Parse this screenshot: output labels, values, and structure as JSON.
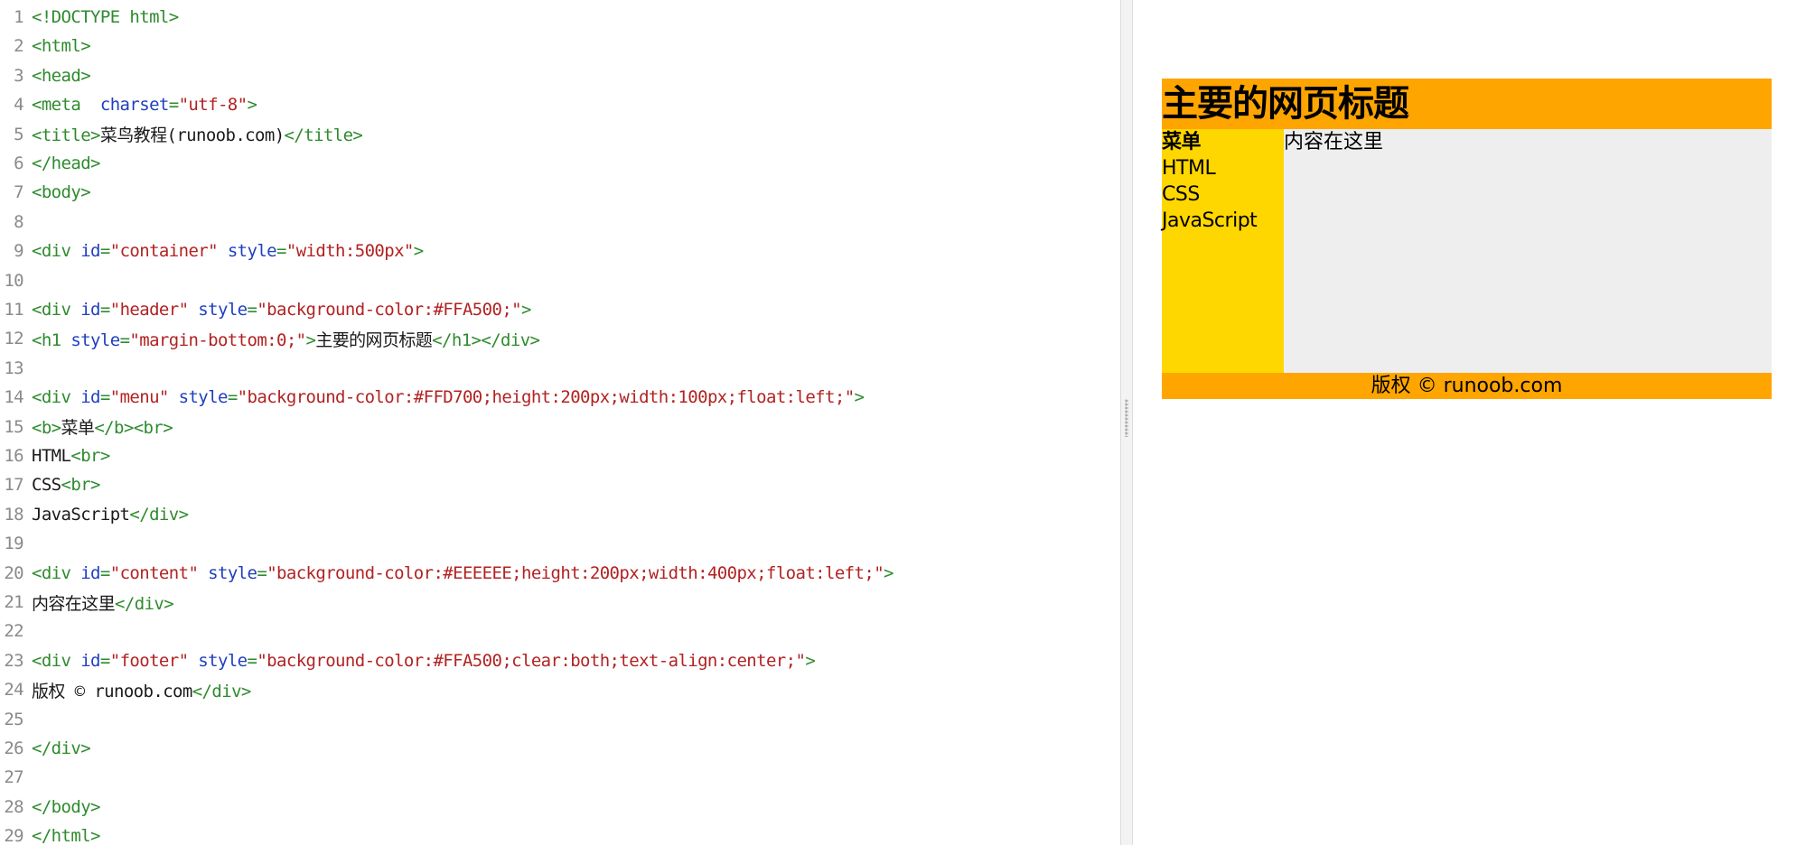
{
  "editor": {
    "lines": [
      {
        "n": "1",
        "segs": [
          {
            "t": "tag",
            "v": "<!DOCTYPE html>"
          }
        ]
      },
      {
        "n": "2",
        "segs": [
          {
            "t": "tag",
            "v": "<html>"
          }
        ]
      },
      {
        "n": "3",
        "segs": [
          {
            "t": "tag",
            "v": "<head>"
          }
        ]
      },
      {
        "n": "4",
        "segs": [
          {
            "t": "tag",
            "v": "<meta  "
          },
          {
            "t": "attr",
            "v": "charset"
          },
          {
            "t": "tag",
            "v": "="
          },
          {
            "t": "val",
            "v": "\"utf-8\""
          },
          {
            "t": "tag",
            "v": ">"
          }
        ]
      },
      {
        "n": "5",
        "segs": [
          {
            "t": "tag",
            "v": "<title>"
          },
          {
            "t": "text",
            "v": "菜鸟教程(runoob.com)"
          },
          {
            "t": "tag",
            "v": "</title>"
          }
        ]
      },
      {
        "n": "6",
        "segs": [
          {
            "t": "tag",
            "v": "</head>"
          }
        ]
      },
      {
        "n": "7",
        "segs": [
          {
            "t": "tag",
            "v": "<body>"
          }
        ]
      },
      {
        "n": "8",
        "segs": []
      },
      {
        "n": "9",
        "segs": [
          {
            "t": "tag",
            "v": "<div "
          },
          {
            "t": "attr",
            "v": "id"
          },
          {
            "t": "tag",
            "v": "="
          },
          {
            "t": "val",
            "v": "\"container\""
          },
          {
            "t": "tag",
            "v": " "
          },
          {
            "t": "attr",
            "v": "style"
          },
          {
            "t": "tag",
            "v": "="
          },
          {
            "t": "val",
            "v": "\"width:500px\""
          },
          {
            "t": "tag",
            "v": ">"
          }
        ]
      },
      {
        "n": "10",
        "segs": []
      },
      {
        "n": "11",
        "segs": [
          {
            "t": "tag",
            "v": "<div "
          },
          {
            "t": "attr",
            "v": "id"
          },
          {
            "t": "tag",
            "v": "="
          },
          {
            "t": "val",
            "v": "\"header\""
          },
          {
            "t": "tag",
            "v": " "
          },
          {
            "t": "attr",
            "v": "style"
          },
          {
            "t": "tag",
            "v": "="
          },
          {
            "t": "val",
            "v": "\"background-color:#FFA500;\""
          },
          {
            "t": "tag",
            "v": ">"
          }
        ]
      },
      {
        "n": "12",
        "segs": [
          {
            "t": "tag",
            "v": "<h1 "
          },
          {
            "t": "attr",
            "v": "style"
          },
          {
            "t": "tag",
            "v": "="
          },
          {
            "t": "val",
            "v": "\"margin-bottom:0;\""
          },
          {
            "t": "tag",
            "v": ">"
          },
          {
            "t": "text",
            "v": "主要的网页标题"
          },
          {
            "t": "tag",
            "v": "</h1></div>"
          }
        ]
      },
      {
        "n": "13",
        "segs": []
      },
      {
        "n": "14",
        "segs": [
          {
            "t": "tag",
            "v": "<div "
          },
          {
            "t": "attr",
            "v": "id"
          },
          {
            "t": "tag",
            "v": "="
          },
          {
            "t": "val",
            "v": "\"menu\""
          },
          {
            "t": "tag",
            "v": " "
          },
          {
            "t": "attr",
            "v": "style"
          },
          {
            "t": "tag",
            "v": "="
          },
          {
            "t": "val",
            "v": "\"background-color:#FFD700;height:200px;width:100px;float:left;\""
          },
          {
            "t": "tag",
            "v": ">"
          }
        ]
      },
      {
        "n": "15",
        "segs": [
          {
            "t": "tag",
            "v": "<b>"
          },
          {
            "t": "text",
            "v": "菜单"
          },
          {
            "t": "tag",
            "v": "</b><br>"
          }
        ]
      },
      {
        "n": "16",
        "segs": [
          {
            "t": "text",
            "v": "HTML"
          },
          {
            "t": "tag",
            "v": "<br>"
          }
        ]
      },
      {
        "n": "17",
        "segs": [
          {
            "t": "text",
            "v": "CSS"
          },
          {
            "t": "tag",
            "v": "<br>"
          }
        ]
      },
      {
        "n": "18",
        "segs": [
          {
            "t": "text",
            "v": "JavaScript"
          },
          {
            "t": "tag",
            "v": "</div>"
          }
        ]
      },
      {
        "n": "19",
        "segs": []
      },
      {
        "n": "20",
        "segs": [
          {
            "t": "tag",
            "v": "<div "
          },
          {
            "t": "attr",
            "v": "id"
          },
          {
            "t": "tag",
            "v": "="
          },
          {
            "t": "val",
            "v": "\"content\""
          },
          {
            "t": "tag",
            "v": " "
          },
          {
            "t": "attr",
            "v": "style"
          },
          {
            "t": "tag",
            "v": "="
          },
          {
            "t": "val",
            "v": "\"background-color:#EEEEEE;height:200px;width:400px;float:left;\""
          },
          {
            "t": "tag",
            "v": ">"
          }
        ]
      },
      {
        "n": "21",
        "segs": [
          {
            "t": "text",
            "v": "内容在这里"
          },
          {
            "t": "tag",
            "v": "</div>"
          }
        ]
      },
      {
        "n": "22",
        "segs": []
      },
      {
        "n": "23",
        "segs": [
          {
            "t": "tag",
            "v": "<div "
          },
          {
            "t": "attr",
            "v": "id"
          },
          {
            "t": "tag",
            "v": "="
          },
          {
            "t": "val",
            "v": "\"footer\""
          },
          {
            "t": "tag",
            "v": " "
          },
          {
            "t": "attr",
            "v": "style"
          },
          {
            "t": "tag",
            "v": "="
          },
          {
            "t": "val",
            "v": "\"background-color:#FFA500;clear:both;text-align:center;\""
          },
          {
            "t": "tag",
            "v": ">"
          }
        ]
      },
      {
        "n": "24",
        "segs": [
          {
            "t": "text",
            "v": "版权 © runoob.com"
          },
          {
            "t": "tag",
            "v": "</div>"
          }
        ]
      },
      {
        "n": "25",
        "segs": []
      },
      {
        "n": "26",
        "segs": [
          {
            "t": "tag",
            "v": "</div>"
          }
        ]
      },
      {
        "n": "27",
        "segs": []
      },
      {
        "n": "28",
        "segs": [
          {
            "t": "tag",
            "v": "</body>"
          }
        ]
      },
      {
        "n": "29",
        "segs": [
          {
            "t": "tag",
            "v": "</html>"
          }
        ]
      }
    ]
  },
  "preview": {
    "header_title": "主要的网页标题",
    "menu": {
      "title": "菜单",
      "items": [
        "HTML",
        "CSS",
        "JavaScript"
      ]
    },
    "content_text": "内容在这里",
    "footer_text": "版权 © runoob.com",
    "colors": {
      "header": "#FFA500",
      "menu": "#FFD700",
      "content": "#EEEEEE",
      "footer": "#FFA500"
    }
  }
}
